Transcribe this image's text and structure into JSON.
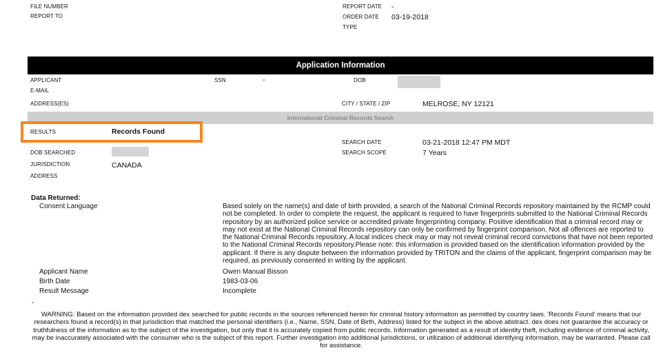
{
  "header": {
    "file_number_label": "FILE NUMBER",
    "report_to_label": "REPORT TO",
    "report_date_label": "REPORT DATE",
    "report_date_value": "-",
    "order_date_label": "ORDER DATE",
    "order_date_value": "03-19-2018",
    "type_label": "TYPE"
  },
  "application": {
    "section_title": "Application Information",
    "applicant_label": "APPLICANT",
    "ssn_label": "SSN",
    "ssn_value": "-",
    "dob_label": "DOB",
    "email_label": "E-MAIL",
    "addresses_label": "ADDRESS(ES)",
    "city_label": "CITY / STATE / ZIP",
    "city_value": "MELROSE, NY 12121"
  },
  "search": {
    "section_title": "International Criminal Records Search",
    "results_label": "RESULTS",
    "results_value": "Records Found",
    "dob_searched_label": "DOB SEARCHED",
    "jurisdiction_label": "JURISDICTION",
    "jurisdiction_value": "CANADA",
    "address_label": "ADDRESS",
    "search_date_label": "SEARCH DATE",
    "search_date_value": "03-21-2018 12:47 PM MDT",
    "search_scope_label": "SEARCH SCOPE",
    "search_scope_value": "7 Years"
  },
  "data_returned": {
    "title": "Data Returned:",
    "consent_label": "Consent Language",
    "consent_text": "Based solely on the name(s) and date of birth provided, a search of the National Criminal Records repository maintained by the RCMP could not be completed. In order to complete the request, the applicant is required to have fingerprints submitted to the National Criminal Records repository by an authorized police service or accredited private fingerprinting company. Positive identification that a criminal record may or may not exist at the National Criminal Records repository can only be confirmed by fingerprint comparison. Not all offences are reported to the National Criminal Records repository. A local indices check may or may not reveal criminal record convictions that have not been reported to the National Criminal Records repository.Please note: this information is provided based on the identification information provided by the applicant. If there is any dispute between the information provided by TRITON and the claims of the applicant, fingerprint comparison may be required, as previously consented in writing by the applicant.",
    "applicant_name_label": "Applicant Name",
    "applicant_name_value": "Owen Manual Bisson",
    "birth_date_label": "Birth Date",
    "birth_date_value": "1983-03-06",
    "result_message_label": "Result Message",
    "result_message_value": "Incomplete",
    "dash": "-"
  },
  "warning": "WARNING: Based on the information provided dex searched for public records in the sources referenced herein for criminal history information as permitted by country laws. 'Records Found' means that our researchers found a record(s) in that jurisdiction that matched the personal identifiers (i.e., Name, SSN, Date of Birth, Address) listed for the subject in the above abstract. dex does not guarantee the accuracy or truthfulness of the information as to the subject of the investigation, but only that it is accurately copied from public records. Information generated as a result of identity theft, including evidence of criminal activity, may be inaccurately associated with the consumer who is the subject of this report. Further investigation into additional jurisdictions, or utilization of additional identifying information, may be warranted. Please call for assistance.",
  "colors": {
    "highlight": "#f7851d",
    "header_bar": "#000000",
    "section_bar": "#cfcfcf"
  }
}
